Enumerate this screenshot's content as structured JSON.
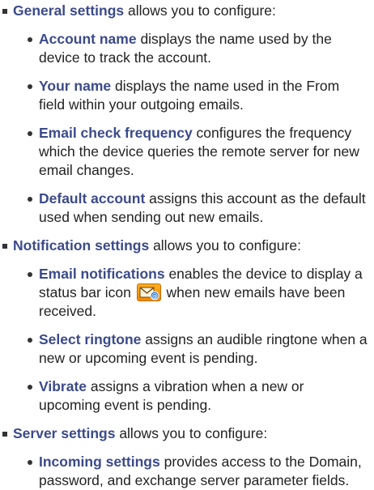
{
  "sections": [
    {
      "term": "General settings",
      "rest": " allows you to configure:",
      "items": [
        {
          "term": "Account name",
          "rest": " displays the name used by the device to track the account."
        },
        {
          "term": "Your name",
          "rest": " displays the name used in the From field within your outgoing emails."
        },
        {
          "term": "Email check frequency",
          "rest": " configures the frequency which the device queries the remote server for new email changes."
        },
        {
          "term": "Default account",
          "rest": " assigns this account as the default used when sending out new emails."
        }
      ]
    },
    {
      "term": "Notification settings",
      "rest": " allows you to configure:",
      "items": [
        {
          "term": "Email notifications",
          "rest_before": " enables the device to display a status bar icon ",
          "icon": "email-status-bar-icon",
          "rest_after": " when new emails have been received."
        },
        {
          "term": "Select ringtone",
          "rest": " assigns an audible ringtone when a new or upcoming event is pending."
        },
        {
          "term": "Vibrate",
          "rest": " assigns a vibration when a new or upcoming event is pending."
        }
      ]
    },
    {
      "term": "Server settings",
      "rest": " allows you to configure:",
      "items": [
        {
          "term": "Incoming settings",
          "rest": " provides access to the Domain, password, and exchange server parameter fields."
        }
      ]
    }
  ],
  "colors": {
    "term": "#3b4a8a",
    "body_text": "#222222",
    "icon_background": "#f08a00"
  }
}
